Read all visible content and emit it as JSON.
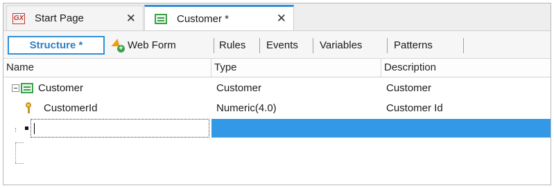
{
  "tabs": [
    {
      "icon": "genexus-logo-icon",
      "logo_text": "GX",
      "label": "Start Page",
      "close": "✕"
    },
    {
      "icon": "transaction-grid-icon",
      "label": "Customer *",
      "close": "✕",
      "active": true
    }
  ],
  "toolbar": {
    "items": [
      {
        "label": "Structure *",
        "selected": true
      },
      {
        "label": "Web Form",
        "icon": "web-form-icon"
      },
      {
        "label": "Rules"
      },
      {
        "label": "Events"
      },
      {
        "label": "Variables"
      },
      {
        "label": "Patterns"
      }
    ]
  },
  "table": {
    "headers": {
      "name": "Name",
      "type": "Type",
      "description": "Description"
    },
    "rows": [
      {
        "name": "Customer",
        "type": "Customer",
        "description": "Customer",
        "icon": "transaction-grid-icon",
        "expanded": true
      },
      {
        "name": "CustomerId",
        "type": "Numeric(4.0)",
        "description": "Customer Id",
        "icon": "primary-key-icon"
      },
      {
        "name": "",
        "type": "",
        "description": "",
        "editing": true
      }
    ]
  },
  "colors": {
    "accent": "#2f8fd8",
    "selection": "#3399e6",
    "key": "#c8931a",
    "grid_icon": "#3aa04a"
  }
}
